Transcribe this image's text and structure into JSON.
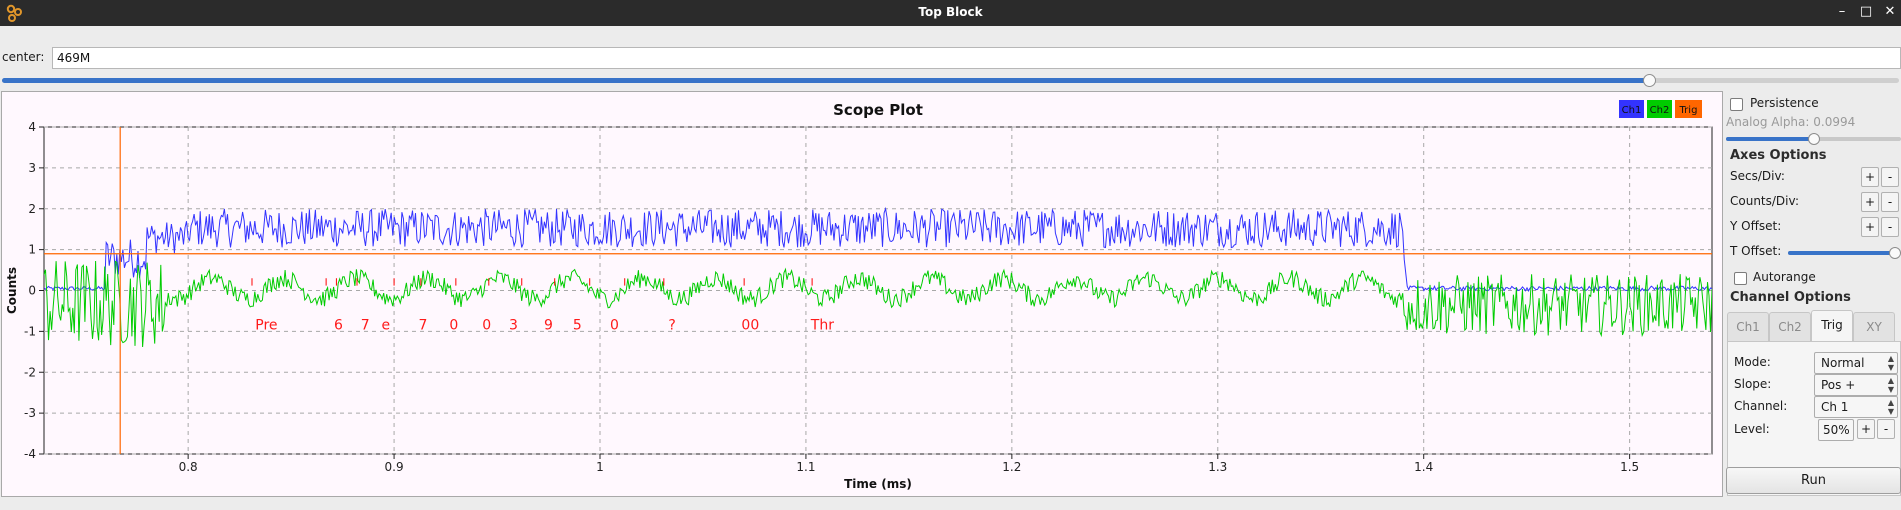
{
  "window": {
    "title": "Top Block",
    "controls": {
      "minimize": "–",
      "maximize": "□",
      "close": "✕"
    }
  },
  "center": {
    "label": "center:",
    "value": "469M",
    "slider_fraction": 0.868
  },
  "plot": {
    "title": "Scope Plot",
    "legend": [
      {
        "label": "Ch1",
        "color": "#3333ff"
      },
      {
        "label": "Ch2",
        "color": "#00cc00"
      },
      {
        "label": "Trig",
        "color": "#ff6600"
      }
    ],
    "decoded_tokens": [
      "Pre",
      "6",
      "7",
      "e",
      "7",
      "0",
      "0",
      "3",
      "9",
      "5",
      "0",
      "?",
      "00",
      "Thr"
    ]
  },
  "chart_data": {
    "type": "line",
    "title": "Scope Plot",
    "xlabel": "Time (ms)",
    "ylabel": "Counts",
    "xlim": [
      0.73,
      1.54
    ],
    "ylim": [
      -4,
      4
    ],
    "xticks": [
      0.8,
      0.9,
      1,
      1.1,
      1.2,
      1.3,
      1.4,
      1.5
    ],
    "xtick_labels": [
      "0.8",
      "0.9",
      "1",
      "1.1",
      "1.2",
      "1.3",
      "1.4",
      "1.5"
    ],
    "yticks": [
      -4,
      -3,
      -2,
      -1,
      0,
      1,
      2,
      3,
      4
    ],
    "ytick_labels": [
      "-4",
      "-3",
      "-2",
      "-1",
      "0",
      "1",
      "2",
      "3",
      "4"
    ],
    "grid": true,
    "legend_position": "top-right",
    "trigger_level": 0.9,
    "trigger_time": 0.767,
    "series": [
      {
        "name": "Ch1",
        "color": "#3333ff",
        "description_points": [
          [
            0.73,
            0.05
          ],
          [
            0.76,
            0.1
          ],
          [
            0.77,
            0.9
          ],
          [
            0.78,
            1.0
          ],
          [
            0.8,
            1.4
          ],
          [
            1.39,
            1.4
          ],
          [
            1.392,
            0.05
          ],
          [
            1.54,
            0.05
          ]
        ]
      },
      {
        "name": "Ch2",
        "color": "#00cc00",
        "description_points": [
          [
            0.73,
            -0.6
          ],
          [
            0.8,
            0.2
          ],
          [
            1.0,
            0.1
          ],
          [
            1.2,
            0.0
          ],
          [
            1.39,
            0.0
          ],
          [
            1.4,
            -0.6
          ],
          [
            1.54,
            -0.4
          ]
        ]
      },
      {
        "name": "Trig",
        "color": "#ff6600"
      }
    ]
  },
  "sidebar": {
    "persistence_label": "Persistence",
    "analog_alpha_label": "Analog Alpha: 0.0994",
    "analog_alpha_fraction": 0.5,
    "axes_options_label": "Axes Options",
    "secs_div_label": "Secs/Div:",
    "counts_div_label": "Counts/Div:",
    "y_offset_label": "Y Offset:",
    "t_offset_label": "T Offset:",
    "t_offset_fraction": 0.97,
    "plus": "+",
    "minus": "-",
    "autorange_label": "Autorange",
    "channel_options_label": "Channel Options",
    "tabs": [
      "Ch1",
      "Ch2",
      "Trig",
      "XY"
    ],
    "active_tab": "Trig",
    "mode_label": "Mode:",
    "mode_value": "Normal",
    "slope_label": "Slope:",
    "slope_value": "Pos +",
    "channel_label": "Channel:",
    "channel_value": "Ch 1",
    "level_label": "Level:",
    "level_value": "50%",
    "run_label": "Run"
  }
}
